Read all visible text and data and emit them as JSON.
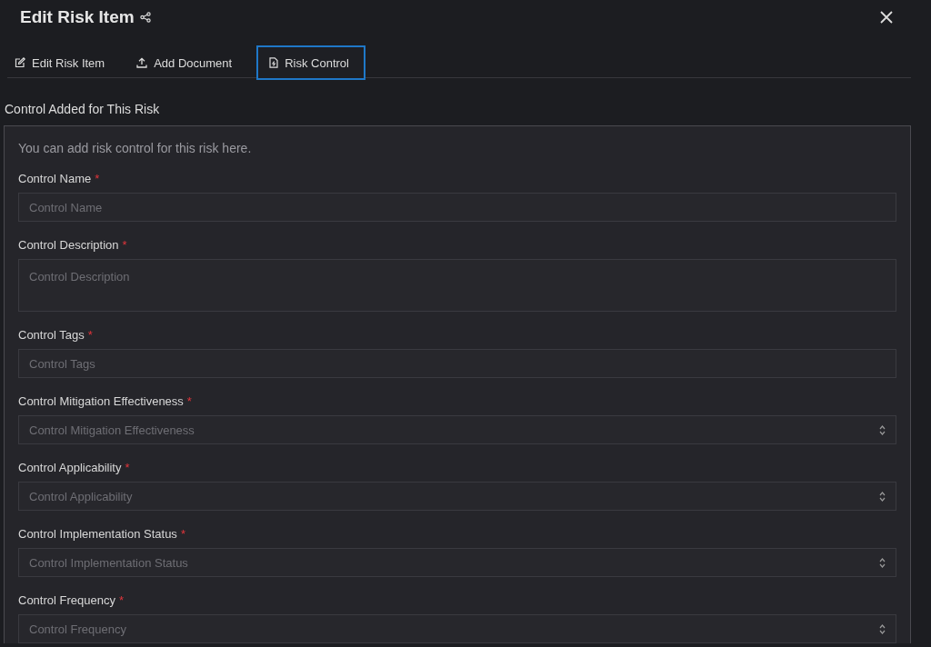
{
  "dialog": {
    "title": "Edit Risk Item"
  },
  "tabs": [
    {
      "label": "Edit Risk Item",
      "selected": false
    },
    {
      "label": "Add Document",
      "selected": false
    },
    {
      "label": "Risk Control",
      "selected": true
    }
  ],
  "section_title": "Control Added for This Risk",
  "panel": {
    "description": "You can add risk control for this risk here.",
    "fields": [
      {
        "label": "Control Name",
        "required_mark": "*",
        "kind": "text",
        "placeholder": "Control Name"
      },
      {
        "label": "Control Description",
        "required_mark": "*",
        "kind": "textarea",
        "placeholder": "Control Description"
      },
      {
        "label": "Control Tags",
        "required_mark": "*",
        "kind": "text",
        "placeholder": "Control Tags"
      },
      {
        "label": "Control Mitigation Effectiveness",
        "required_mark": "*",
        "kind": "select",
        "placeholder": "Control Mitigation Effectiveness"
      },
      {
        "label": "Control Applicability",
        "required_mark": "*",
        "kind": "select",
        "placeholder": "Control Applicability"
      },
      {
        "label": "Control Implementation Status",
        "required_mark": "*",
        "kind": "select",
        "placeholder": "Control Implementation Status"
      },
      {
        "label": "Control Frequency",
        "required_mark": "*",
        "kind": "select",
        "placeholder": "Control Frequency"
      }
    ]
  }
}
